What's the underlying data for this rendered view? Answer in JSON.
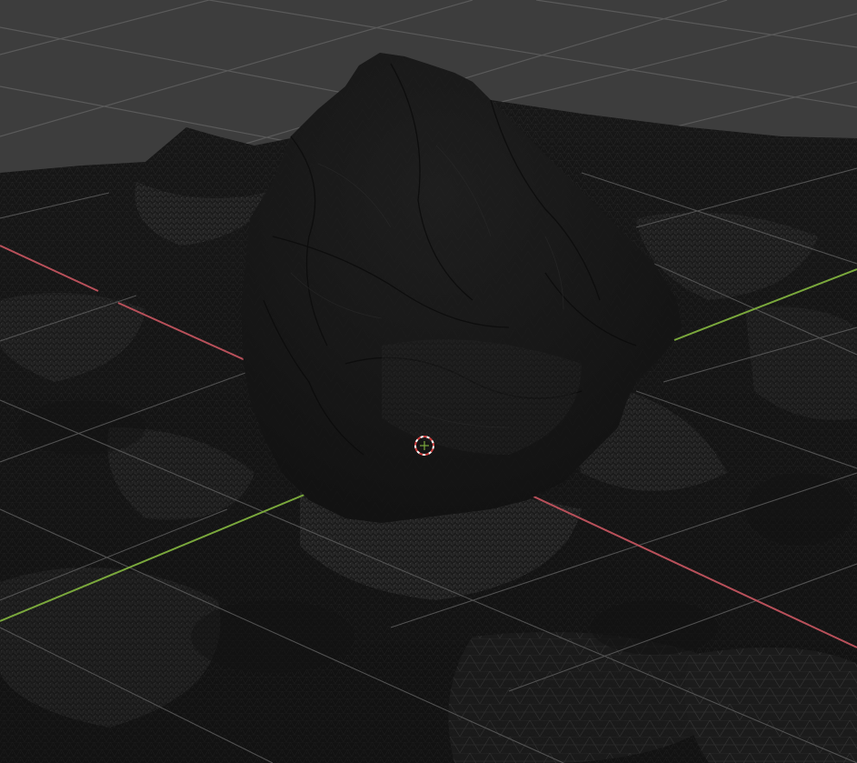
{
  "viewport": {
    "view": "perspective",
    "shading": "solid",
    "overlay": "wireframe",
    "object": "rock-scan-mesh"
  },
  "colors": {
    "background": "#3d3d3d",
    "grid_line": "#5a5a5a",
    "axis_x": "#b8505a",
    "axis_y": "#7aa83c",
    "axis_z": "#4a6cc8",
    "mesh_fill": "#1c1c1c",
    "mesh_dark": "#141414",
    "wire": "#6a6a6a",
    "cursor_red": "#d04040",
    "cursor_white": "#ffffff"
  },
  "icons": {
    "cursor": "3d-cursor-icon",
    "origin": "world-origin-icon"
  }
}
